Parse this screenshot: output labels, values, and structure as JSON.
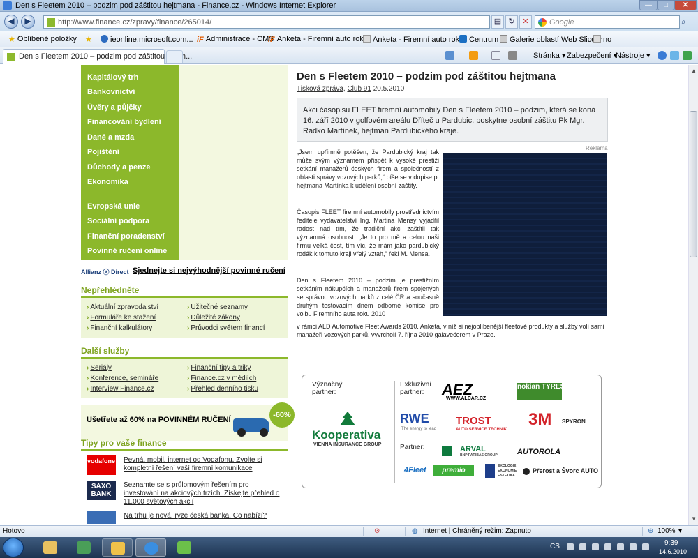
{
  "window": {
    "title": "Den s Fleetem 2010 – podzim pod záštitou hejtmana - Finance.cz - Windows Internet Explorer",
    "min": "—",
    "max": "□",
    "close": "✕"
  },
  "address_bar": {
    "url": "http://www.finance.cz/zpravy/finance/265014/",
    "search_placeholder": "Google",
    "back": "◀",
    "forward": "▶",
    "refresh": "↻",
    "stop": "✕"
  },
  "favorites": [
    {
      "label": "Oblíbené položky",
      "icon": "star-icon"
    },
    {
      "label": "ieonline.microsoft.com...",
      "icon": "ie-icon"
    },
    {
      "label": "Administrace - CMS",
      "icon": "if-icon"
    },
    {
      "label": "Anketa - Firemní auto rok...",
      "icon": "if-icon"
    },
    {
      "label": "Anketa - Firemní auto rok...",
      "icon": "page-icon"
    },
    {
      "label": "Centrum",
      "icon": "centrum-icon"
    },
    {
      "label": "Galerie oblastí Web Slice",
      "icon": "slice-icon"
    },
    {
      "label": "no",
      "icon": "page-icon"
    }
  ],
  "tab": {
    "label": "Den s Fleetem 2010 – podzim pod záštitou hejtm..."
  },
  "commands": {
    "page": "Stránka ▾",
    "security": "Zabezpečení ▾",
    "tools": "Nástroje ▾"
  },
  "left_nav": {
    "group1": [
      "Kapitálový trh",
      "Bankovnictví",
      "Úvěry a půjčky",
      "Financování bydlení",
      "Daně a mzda",
      "Pojištění",
      "Důchody a penze",
      "Ekonomika"
    ],
    "group2": [
      "Evropská unie",
      "Sociální podpora",
      "Finanční poradenství",
      "Povinné ručení online"
    ]
  },
  "allianz": {
    "logo": "Allianz ⓐ Direct",
    "link": "Sjednejte si nejvýhodnější povinné ručení"
  },
  "neprehlednete": {
    "title": "Nepřehlédněte",
    "links": [
      "Aktuální zpravodajství",
      "Užitečné seznamy",
      "Formuláře ke stažení",
      "Důležité zákony",
      "Finanční kalkulátory",
      "Průvodci světem financí"
    ]
  },
  "dalsi_sluzby": {
    "title": "Další služby",
    "links": [
      "Seriály",
      "Finanční tipy a triky",
      "Konference, semináře",
      "Finance.cz v médiích",
      "Interview Finance.cz",
      "Přehled denního tisku"
    ]
  },
  "povinne": {
    "text": "Ušetřete až 60% na POVINNÉM RUČENÍ",
    "badge": "-60%"
  },
  "tipy": {
    "title": "Tipy pro vaše finance",
    "items": [
      {
        "logo": "vodafone",
        "text": "Pevná, mobil, internet od Vodafonu. Zvolte si kompletní řešení vaší firemní komunikace",
        "color": "#e60000"
      },
      {
        "logo": "SAXO BANK",
        "text": "Seznamte se s průlomovým řešením pro investování na akciových trzích. Získejte přehled o 11.000 světových akcií",
        "color": "#1b2a4e"
      },
      {
        "logo": "",
        "text": "Na trhu je nová, ryze česká banka. Co nabízí?",
        "color": "#3a6db5"
      }
    ]
  },
  "article": {
    "title": "Den s Fleetem 2010 – podzim pod záštitou hejtmana",
    "meta_type": "Tisková zpráva",
    "meta_source": "Club 91",
    "meta_date": "20.5.2010",
    "lead": "Akci časopisu FLEET firemní automobily Den s Fleetem 2010  – podzim, která se koná 16. září 2010 v golfovém areálu Dříteč u Pardubic, poskytne osobní záštitu Pk Mgr. Radko Martínek, hejtman Pardubického kraje.",
    "p1": "„Jsem upřímně potěšen, že Pardubický kraj tak může svým významem přispět k vysoké prestiži setkání manažerů českých firem a společností z oblasti správy vozových parků,“ píše se v dopise p. hejtmana Martínka k udělení osobní záštity.",
    "p2": "Časopis FLEET firemní automobily prostřednictvím ředitele vydavatelství Ing. Martina Mensy vyjádřil radost nad tím, že tradiční akci zaštítil tak významná osobnost. „Je to pro mě a celou naši firmu velká čest, tím víc, že mám jako pardubický rodák k tomuto kraji vřelý vztah,“ řekl M. Mensa.",
    "p3a": "Den s Fleetem 2010 – podzim je prestižním setkáním nákupčích a manažerů firem spojených se správou vozových parků z celé ČR a současně druhým testovacím dnem odborné komise pro volbu Firemního auta roku 2010",
    "p3b": "v rámci ALD Automotive Fleet Awards 2010. Anketa, v níž si nejoblíbenější fleetové produkty a služby volí sami manažeři vozových parků, vyvrcholí 7. října 2010 galavečerem v Praze.",
    "reklama": "Reklama"
  },
  "partners": {
    "significant_label": "Význačný partner:",
    "exclusive_label": "Exkluzivní partner:",
    "partner_label": "Partner:",
    "kooperativa": "Kooperativa",
    "kooperativa_sub": "VIENNA INSURANCE GROUP",
    "logos": {
      "aez": "AEZ",
      "aez_sub": "WWW.ALCAR.CZ",
      "nokian": "nokian TYRES",
      "rwe": "RWE",
      "rwe_sub": "The energy to lead",
      "trost": "TROST",
      "trost_sub": "AUTO SERVICE TECHNIK",
      "three_m": "3M",
      "spyron": "SPYRON",
      "arval": "ARVAL",
      "arval_sub": "BNP PARIBAS GROUP",
      "autorola": "AUTOROLA",
      "fleet4": "4Fleet",
      "premio": "premio",
      "eko": "EKOLOGIE EKONOMIE ESTETIKA",
      "prerost": "Přerost a Švorc AUTO"
    }
  },
  "status": {
    "left": "Hotovo",
    "zone": "Internet | Chráněný režim: Zapnuto",
    "zoom": "100%"
  },
  "taskbar": {
    "lang": "CS",
    "time": "9:39",
    "date": "14.6.2010"
  }
}
